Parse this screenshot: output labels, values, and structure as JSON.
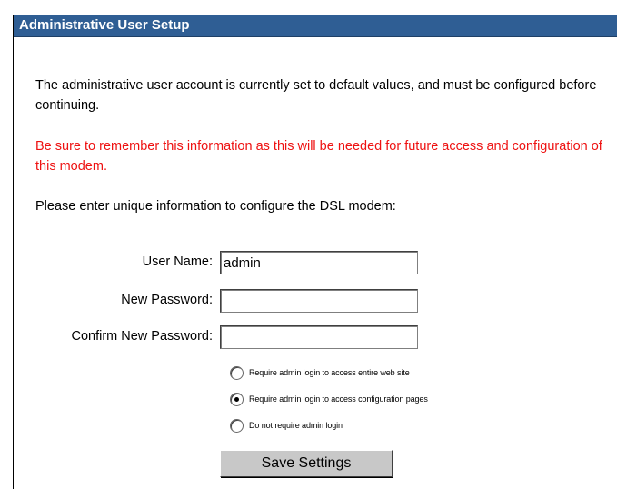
{
  "header": {
    "title": "Administrative User Setup"
  },
  "intro": "The administrative user account is currently set to default values, and must be configured before continuing.",
  "warning": "Be sure to remember this information as this will be needed for future access and configuration of this modem.",
  "instruction": "Please enter unique information to configure the DSL modem:",
  "form": {
    "username_label": "User Name:",
    "username_value": "admin",
    "new_password_label": "New Password:",
    "new_password_value": "",
    "confirm_password_label": "Confirm New Password:",
    "confirm_password_value": ""
  },
  "login_options": [
    {
      "label": "Require admin login to access entire web site",
      "checked": false
    },
    {
      "label": "Require admin login to access configuration pages",
      "checked": true
    },
    {
      "label": "Do not require admin login",
      "checked": false
    }
  ],
  "save_label": "Save Settings",
  "colors": {
    "header_bg": "#2f5e94",
    "warning_text": "#ee1111",
    "button_bg": "#c8c8c8"
  }
}
